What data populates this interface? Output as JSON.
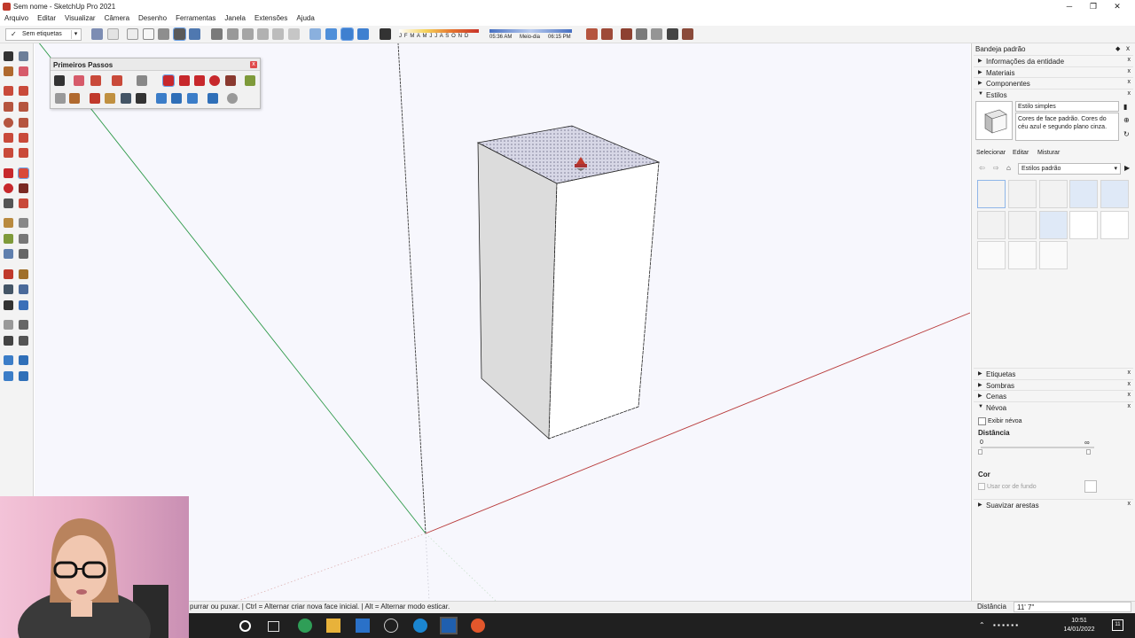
{
  "window": {
    "title": "Sem nome - SketchUp Pro 2021",
    "controls": [
      "─",
      "❐",
      "✕"
    ]
  },
  "menu": [
    "Arquivo",
    "Editar",
    "Visualizar",
    "Câmera",
    "Desenho",
    "Ferramentas",
    "Janela",
    "Extensões",
    "Ajuda"
  ],
  "toolbar": {
    "tag_check": "✓",
    "tag_select": "Sem etiquetas",
    "months": "J F M A M J J A S O N D",
    "time_start": "05:36 AM",
    "time_mid": "Meio-dia",
    "time_end": "06:15 PM"
  },
  "first_steps": {
    "title": "Primeiros Passos",
    "close": "x"
  },
  "tray": {
    "title": "Bandeja padrão",
    "sections_top": [
      {
        "label": "Informações da entidade",
        "arrow": "▶"
      },
      {
        "label": "Materiais",
        "arrow": "▶"
      },
      {
        "label": "Componentes",
        "arrow": "▶"
      },
      {
        "label": "Estilos",
        "arrow": "▼"
      }
    ],
    "style": {
      "name": "Estilo simples",
      "description": "Cores de face padrão. Cores do céu azul e segundo plano cinza.",
      "tabs": [
        "Selecionar",
        "Editar",
        "Misturar"
      ],
      "library": "Estilos padrão"
    },
    "sections_bottom": [
      {
        "label": "Etiquetas",
        "arrow": "▶"
      },
      {
        "label": "Sombras",
        "arrow": "▶"
      },
      {
        "label": "Cenas",
        "arrow": "▶"
      },
      {
        "label": "Névoa",
        "arrow": "▼"
      }
    ],
    "fog": {
      "show_label": "Exibir névoa",
      "distance_label": "Distância",
      "range_start": "0",
      "range_end": "∞",
      "color_label": "Cor",
      "bg_color_label": "Usar cor de fundo"
    },
    "last_section": {
      "label": "Suavizar arestas",
      "arrow": "▶"
    },
    "close_glyph": "x"
  },
  "status": {
    "text": "purrar ou puxar. | Ctrl = Alternar criar nova face inicial. | Alt = Alternar modo esticar.",
    "measure_label": "Distância",
    "measure_value": "11' 7\""
  },
  "taskbar": {
    "time": "10:51",
    "date": "14/01/2022",
    "notif": "11"
  },
  "colors": {
    "accent_red": "#c0392b",
    "sky": "#f7f7fd",
    "taskbar": "#202020",
    "axis_green": "#2e9a4a",
    "axis_red": "#b83a3a"
  }
}
